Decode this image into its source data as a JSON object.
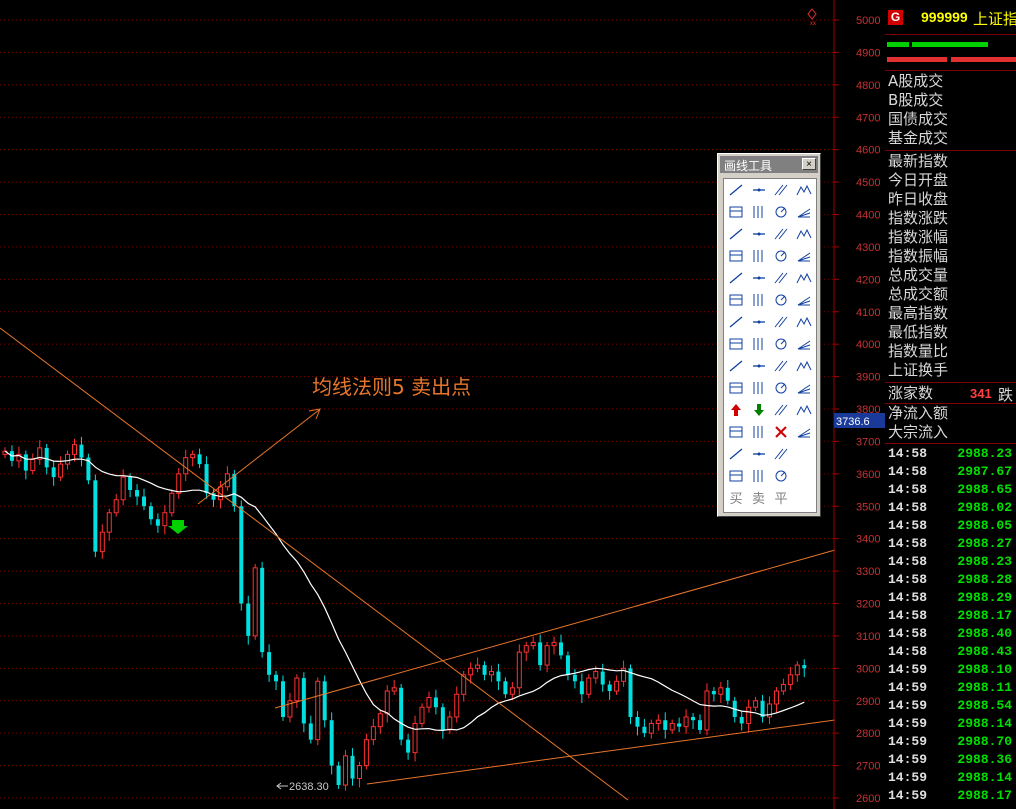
{
  "chart_data": {
    "type": "candlestick",
    "y_axis": {
      "ticks": [
        "5000",
        "4900",
        "4800",
        "4700",
        "4600",
        "4500",
        "4400",
        "4300",
        "4200",
        "4100",
        "4000",
        "3900",
        "3800",
        "3700",
        "3600",
        "3500",
        "3400",
        "3300",
        "3200",
        "3100",
        "3000",
        "2900",
        "2800",
        "2700",
        "2600"
      ],
      "ylim": [
        2580,
        5030
      ],
      "grid": "dotted horizontal"
    },
    "current_value_label": "3736.6",
    "low_label": "2638.30",
    "annotation": "均线法则5  卖出点",
    "closes": [
      3670,
      3640,
      3660,
      3610,
      3645,
      3680,
      3620,
      3590,
      3630,
      3660,
      3690,
      3650,
      3580,
      3360,
      3420,
      3480,
      3520,
      3590,
      3550,
      3530,
      3500,
      3460,
      3440,
      3480,
      3540,
      3600,
      3650,
      3660,
      3630,
      3540,
      3520,
      3560,
      3600,
      3500,
      3200,
      3100,
      3310,
      3050,
      2980,
      2960,
      2850,
      2900,
      2970,
      2830,
      2780,
      2960,
      2840,
      2700,
      2640,
      2730,
      2660,
      2700,
      2780,
      2820,
      2860,
      2930,
      2940,
      2780,
      2740,
      2830,
      2880,
      2910,
      2880,
      2810,
      2850,
      2920,
      2980,
      3000,
      3010,
      2980,
      2990,
      2960,
      2920,
      2940,
      3050,
      3070,
      3080,
      3010,
      3070,
      3080,
      3040,
      2980,
      2960,
      2920,
      2970,
      2990,
      2950,
      2930,
      2960,
      3000,
      2850,
      2820,
      2800,
      2830,
      2840,
      2810,
      2830,
      2820,
      2850,
      2840,
      2810,
      2930,
      2920,
      2940,
      2900,
      2850,
      2830,
      2880,
      2900,
      2850,
      2890,
      2930,
      2950,
      2980,
      3010,
      3000
    ]
  },
  "panel": {
    "badge": "G",
    "code": "999999",
    "name": "上证指数",
    "colors": {
      "up": "#ff3030",
      "down": "#00e0e0",
      "ma": "#ffffff",
      "trend": "#e8762a"
    },
    "labels1": [
      "A股成交",
      "B股成交",
      "国债成交",
      "基金成交"
    ],
    "labels2": [
      "最新指数",
      "今日开盘",
      "昨日收盘",
      "指数涨跌",
      "指数涨幅",
      "指数振幅",
      "总成交量",
      "总成交额",
      "最高指数",
      "最低指数",
      "指数量比",
      "上证换手"
    ],
    "zjs_label": "涨家数",
    "zjs_value": "341",
    "zjs_die": "跌",
    "labels3": [
      "净流入额",
      "大宗流入"
    ],
    "ticks": [
      {
        "t": "14:58",
        "p": "2988.23"
      },
      {
        "t": "14:58",
        "p": "2987.67"
      },
      {
        "t": "14:58",
        "p": "2988.65"
      },
      {
        "t": "14:58",
        "p": "2988.02"
      },
      {
        "t": "14:58",
        "p": "2988.05"
      },
      {
        "t": "14:58",
        "p": "2988.27"
      },
      {
        "t": "14:58",
        "p": "2988.23"
      },
      {
        "t": "14:58",
        "p": "2988.28"
      },
      {
        "t": "14:58",
        "p": "2988.29"
      },
      {
        "t": "14:58",
        "p": "2988.17"
      },
      {
        "t": "14:58",
        "p": "2988.40"
      },
      {
        "t": "14:58",
        "p": "2988.43"
      },
      {
        "t": "14:59",
        "p": "2988.10"
      },
      {
        "t": "14:59",
        "p": "2988.11"
      },
      {
        "t": "14:59",
        "p": "2988.54"
      },
      {
        "t": "14:59",
        "p": "2988.14"
      },
      {
        "t": "14:59",
        "p": "2988.70"
      },
      {
        "t": "14:59",
        "p": "2988.36"
      },
      {
        "t": "14:59",
        "p": "2988.14"
      },
      {
        "t": "14:59",
        "p": "2988.17"
      }
    ]
  },
  "toolbox": {
    "title": "画线工具",
    "close": "×",
    "text_buttons": [
      "买",
      "卖",
      "平"
    ],
    "icons": [
      "select-icon",
      "line-icon",
      "ray-icon",
      "arrow-line-icon",
      "segment-icon",
      "h-segment-icon",
      "h-line-icon",
      "h-ray-icon",
      "v-line-icon",
      "price-label-icon",
      "parallel-icon",
      "channel-icon",
      "diag-icon",
      "arc-icon",
      "circle-icon",
      "spiral-icon",
      "w-pattern-icon",
      "m-pattern-icon",
      "wave-icon",
      "zigzag-icon",
      "mountain-icon",
      "gp-icon",
      "ga-icon",
      "g-icon",
      "fib-retrace-icon",
      "fib-level-icon",
      "fan-icon",
      "gann-fan-icon",
      "fib-time-icon",
      "cycle-icon",
      "period-icon",
      "spectrum-icon",
      "bars-icon",
      "dense-bars-icon",
      "vbars-icon",
      "angle-icon",
      "fan-lines-icon",
      "v-pattern-icon",
      "triangle-icon",
      "rect-icon",
      "up-arrow-icon",
      "down-arrow-icon",
      "flag-arrow-icon",
      "text-icon",
      "text-tool-icon",
      "fill-icon",
      "delete-icon",
      "brush-icon",
      "note-icon",
      "ruler-icon",
      "dollar-icon",
      "empty-icon",
      "buy-mark-icon",
      "sell-mark-icon",
      "level-mark-icon",
      "blank-icon"
    ]
  }
}
